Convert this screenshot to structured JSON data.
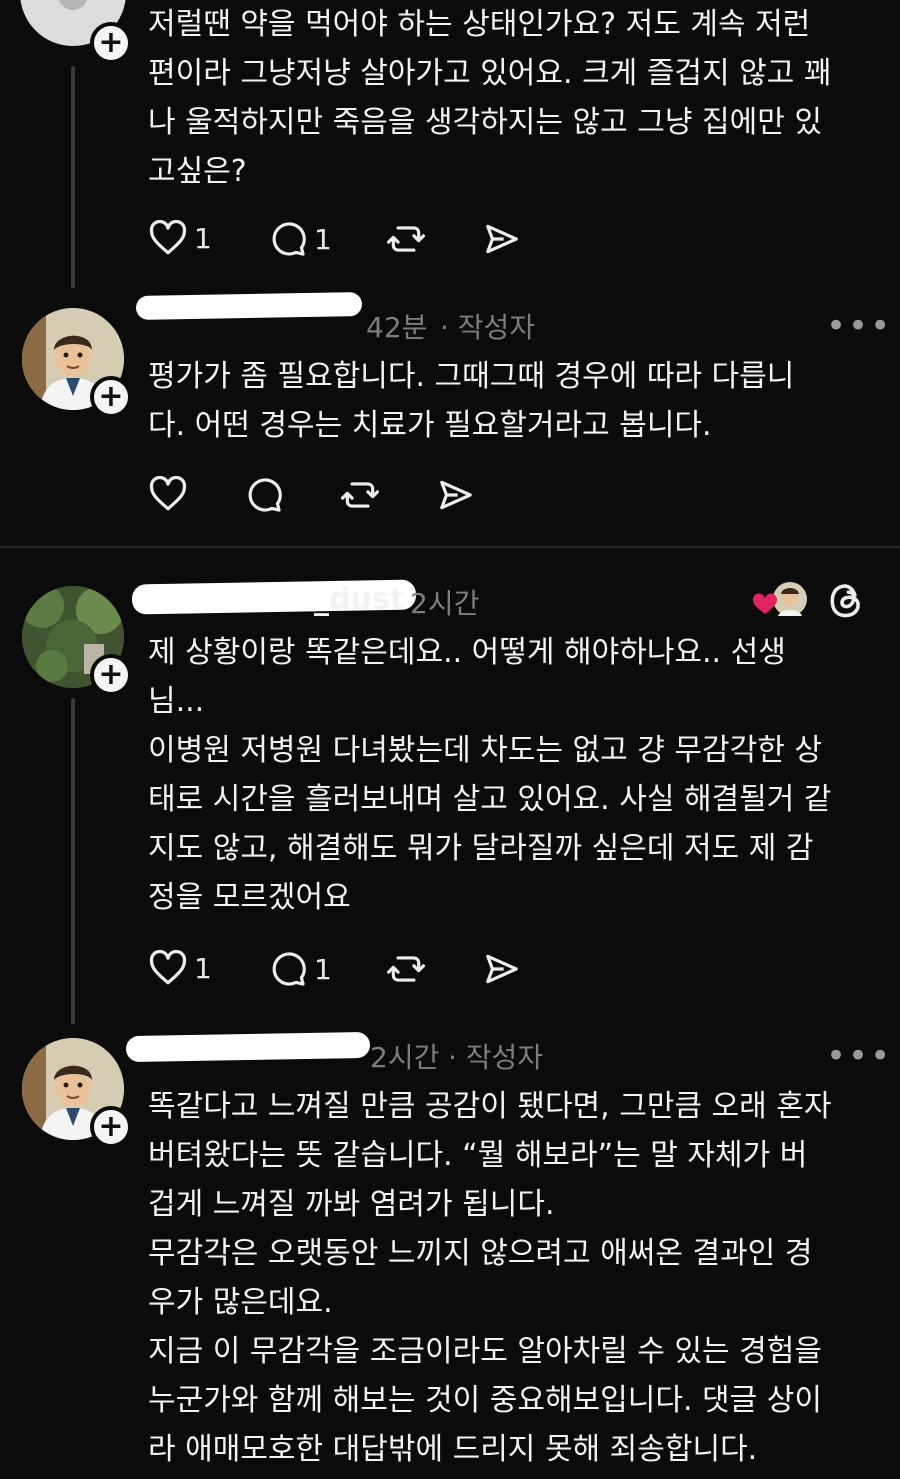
{
  "comments": [
    {
      "text": "저럴땐 약을 먹어야 하는 상태인가요? 저도 계속 저런\n편이라 그냥저냥 살아가고 있어요. 크게 즐겁지 않고 꽤\n나 울적하지만 죽음을 생각하지는 않고 그냥 집에만 있\n고싶은?",
      "likes": "1",
      "replies": "1"
    },
    {
      "time": "42분",
      "author_tag": "· 작성자",
      "text": "평가가 좀 필요합니다. 그때그때 경우에 따라 다릅니\n다. 어떤 경우는 치료가 필요할거라고 봅니다."
    },
    {
      "username_suffix": "_dust",
      "time": "2시간",
      "text": "제 상황이랑 똑같은데요.. 어떻게 해야하나요.. 선생\n님...\n이병원 저병원 다녀봤는데 차도는 없고 걍 무감각한 상\n태로 시간을 흘러보내며 살고 있어요. 사실 해결될거 같\n지도 않고, 해결해도 뭐가 달라질까 싶은데 저도 제 감\n정을 모르겠어요",
      "likes": "1",
      "replies": "1"
    },
    {
      "time": "2시간",
      "author_tag": "· 작성자",
      "text": "똑같다고 느껴질 만큼 공감이 됐다면, 그만큼 오래 혼자\n버텨왔다는 뜻 같습니다. “뭘 해보라”는 말 자체가 버\n겁게 느껴질 까봐 염려가 됩니다.\n무감각은 오랫동안 느끼지 않으려고 애써온 결과인 경\n우가 많은데요.\n지금 이 무감각을 조금이라도 알아차릴 수 있는 경험을\n누군가와 함께 해보는 것이 중요해보입니다. 댓글 상이\n라 애매모호한 대답밖에 드리지 못해 죄송합니다."
    }
  ],
  "more_label": "•••",
  "plus_label": "+",
  "colors": {
    "background": "#0b0b0b",
    "text": "#f3f3f3",
    "meta": "#7d7d7d",
    "heart_red": "#e0245e"
  }
}
